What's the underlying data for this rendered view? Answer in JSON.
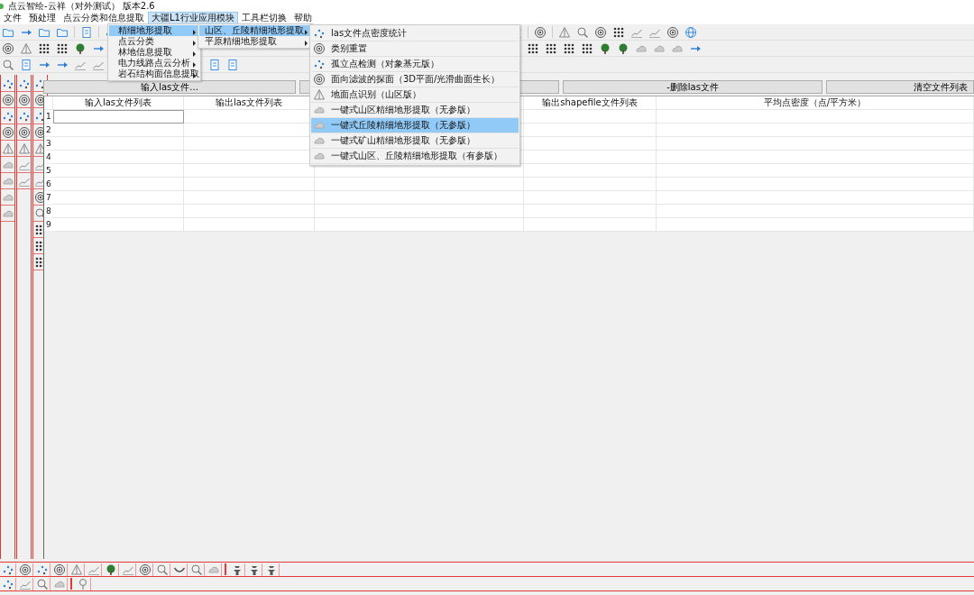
{
  "window": {
    "title": "点云智绘-云祥（对外测试） 版本2.6"
  },
  "menu_bar": [
    {
      "label": "文件",
      "selected": false
    },
    {
      "label": "预处理",
      "selected": false
    },
    {
      "label": "点云分类和信息提取",
      "selected": false
    },
    {
      "label": "大疆L1行业应用模块",
      "selected": true
    },
    {
      "label": "工具栏切换",
      "selected": false
    },
    {
      "label": "帮助",
      "selected": false
    }
  ],
  "action_buttons": [
    {
      "label": "输入las文件..."
    },
    {
      "label": "-删除las文件"
    },
    {
      "label": "清空文件列表"
    }
  ],
  "table": {
    "columns": [
      {
        "kind": "text",
        "label": "输入las文件列表"
      },
      {
        "kind": "text",
        "label": "输出las文件列表"
      },
      {
        "kind": "blank"
      },
      {
        "kind": "text",
        "label": "输出shapefile文件列表"
      },
      {
        "kind": "text",
        "label": "平均点密度（点/平方米）"
      }
    ],
    "rows": [
      {
        "number": "1",
        "editing": true
      },
      {
        "number": "2",
        "editing": false
      },
      {
        "number": "3",
        "editing": false
      },
      {
        "number": "4",
        "editing": false
      },
      {
        "number": "5",
        "editing": false
      },
      {
        "number": "6",
        "editing": false
      },
      {
        "number": "7",
        "editing": false
      },
      {
        "number": "8",
        "editing": false
      },
      {
        "number": "9",
        "editing": false
      }
    ]
  },
  "menus": [
    {
      "items": [
        {
          "label": "精细地形提取",
          "selected": true
        },
        {
          "label": "点云分类",
          "selected": false
        },
        {
          "label": "林地信息提取",
          "selected": false
        },
        {
          "label": "电力线路点云分析",
          "selected": false
        },
        {
          "label": "岩石结构面信息提取",
          "selected": false
        }
      ]
    },
    {
      "items": [
        {
          "label": "山区、丘陵精细地形提取",
          "selected": true
        },
        {
          "label": "平原精细地形提取",
          "selected": false
        }
      ]
    },
    {
      "items": [
        {
          "label": "las文件点密度统计",
          "selected": false
        },
        {
          "label": "类别重置",
          "selected": false
        },
        {
          "label": "孤立点检测（对象基元版）",
          "selected": false
        },
        {
          "label": "面向滤波的探面（3D平面/光滑曲面生长）",
          "selected": false
        },
        {
          "label": "地面点识别（山区版）",
          "selected": false
        },
        {
          "label": "一键式山区精细地形提取（无参版）",
          "selected": false
        },
        {
          "label": "一键式丘陵精细地形提取（无参版）",
          "selected": true
        },
        {
          "label": "一键式矿山精细地形提取（无参版）",
          "selected": false
        },
        {
          "label": "一键式山区、丘陵精细地形提取（有参版）",
          "selected": false
        }
      ]
    }
  ]
}
